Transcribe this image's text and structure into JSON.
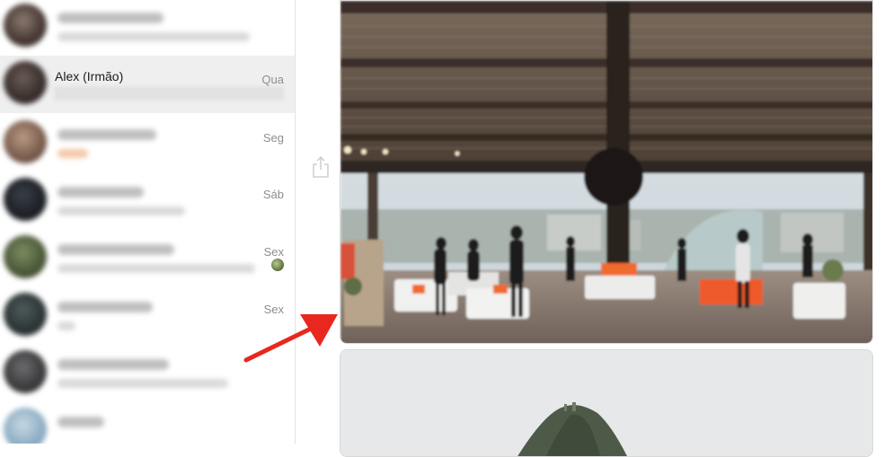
{
  "conversations": [
    {
      "name": "",
      "day": "",
      "selected": false
    },
    {
      "name": "Alex (Irmão)",
      "day": "Qua",
      "selected": true
    },
    {
      "name": "",
      "day": "Seg",
      "selected": false
    },
    {
      "name": "",
      "day": "Sáb",
      "selected": false
    },
    {
      "name": "",
      "day": "Sex",
      "selected": false
    },
    {
      "name": "",
      "day": "Sex",
      "selected": false
    },
    {
      "name": "",
      "day": "",
      "selected": false
    },
    {
      "name": "",
      "day": "",
      "selected": false
    }
  ],
  "icons": {
    "share": "share-icon",
    "annotation": "red-arrow-icon"
  },
  "colors": {
    "selected_row": "#efefef",
    "arrow": "#e8281e",
    "timestamp": "#8e8e93"
  }
}
